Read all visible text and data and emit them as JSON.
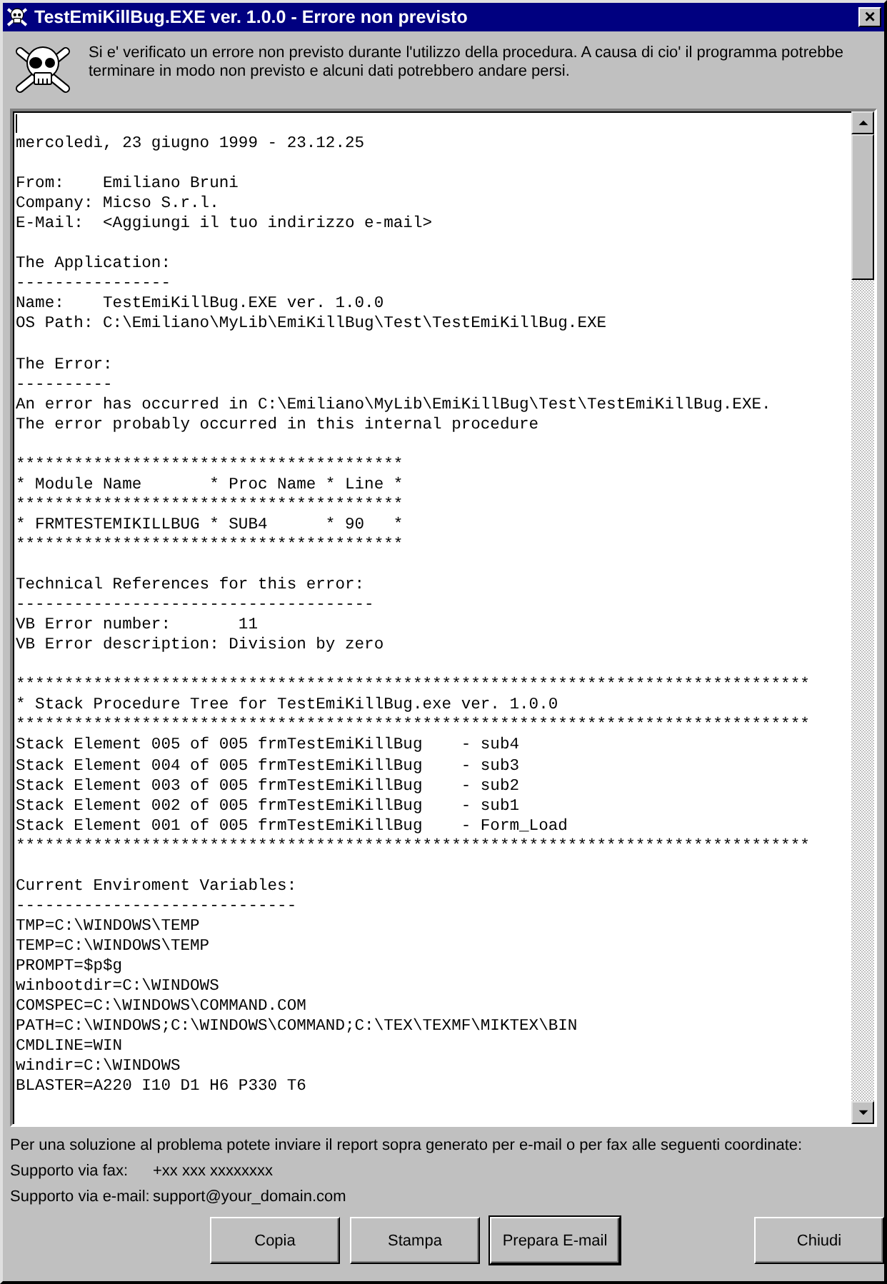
{
  "window": {
    "title": "TestEmiKillBug.EXE ver. 1.0.0 - Errore non previsto",
    "close": "×"
  },
  "header": {
    "message": "Si e' verificato un errore non previsto durante l'utilizzo della procedura. A causa di cio' il programma potrebbe terminare in modo non previsto e alcuni dati potrebbero andare persi."
  },
  "report": {
    "blocks": [
      [
        "mercoledì, 23 giugno 1999 - 23.12.25"
      ],
      [
        "From:    Emiliano Bruni",
        "Company: Micso S.r.l.",
        "E-Mail:  <Aggiungi il tuo indirizzo e-mail>"
      ],
      [
        "The Application:",
        "----------------",
        "Name:    TestEmiKillBug.EXE ver. 1.0.0",
        "OS Path: C:\\Emiliano\\MyLib\\EmiKillBug\\Test\\TestEmiKillBug.EXE"
      ],
      [
        "The Error:",
        "----------",
        "An error has occurred in C:\\Emiliano\\MyLib\\EmiKillBug\\Test\\TestEmiKillBug.EXE.",
        "The error probably occurred in this internal procedure"
      ],
      [
        "****************************************",
        "* Module Name       * Proc Name * Line *",
        "****************************************",
        "* FRMTESTEMIKILLBUG * SUB4      * 90   *",
        "****************************************"
      ],
      [
        "Technical References for this error:",
        "-------------------------------------",
        "VB Error number:       11",
        "VB Error description: Division by zero"
      ],
      [
        "**********************************************************************************",
        "* Stack Procedure Tree for TestEmiKillBug.exe ver. 1.0.0",
        "**********************************************************************************",
        "Stack Element 005 of 005 frmTestEmiKillBug    - sub4",
        "Stack Element 004 of 005 frmTestEmiKillBug    - sub3",
        "Stack Element 003 of 005 frmTestEmiKillBug    - sub2",
        "Stack Element 002 of 005 frmTestEmiKillBug    - sub1",
        "Stack Element 001 of 005 frmTestEmiKillBug    - Form_Load",
        "**********************************************************************************"
      ],
      [
        "Current Enviroment Variables:",
        "-----------------------------",
        "TMP=C:\\WINDOWS\\TEMP",
        "TEMP=C:\\WINDOWS\\TEMP",
        "PROMPT=$p$g",
        "winbootdir=C:\\WINDOWS",
        "COMSPEC=C:\\WINDOWS\\COMMAND.COM",
        "PATH=C:\\WINDOWS;C:\\WINDOWS\\COMMAND;C:\\TEX\\TEXMF\\MIKTEX\\BIN",
        "CMDLINE=WIN",
        "windir=C:\\WINDOWS",
        "BLASTER=A220 I10 D1 H6 P330 T6"
      ]
    ]
  },
  "footer": {
    "intro": "Per una soluzione al problema potete inviare il report sopra generato per e-mail o per fax alle seguenti coordinate:",
    "contacts": [
      {
        "label": "Supporto via fax:",
        "value": "+xx xxx xxxxxxxx"
      },
      {
        "label": "Supporto via e-mail:",
        "value": "support@your_domain.com"
      }
    ]
  },
  "buttons": [
    {
      "label": "Copia",
      "default": false
    },
    {
      "label": "Stampa",
      "default": false
    },
    {
      "label": "Prepara E-mail",
      "default": true
    },
    {
      "label": "Chiudi",
      "default": false
    }
  ]
}
